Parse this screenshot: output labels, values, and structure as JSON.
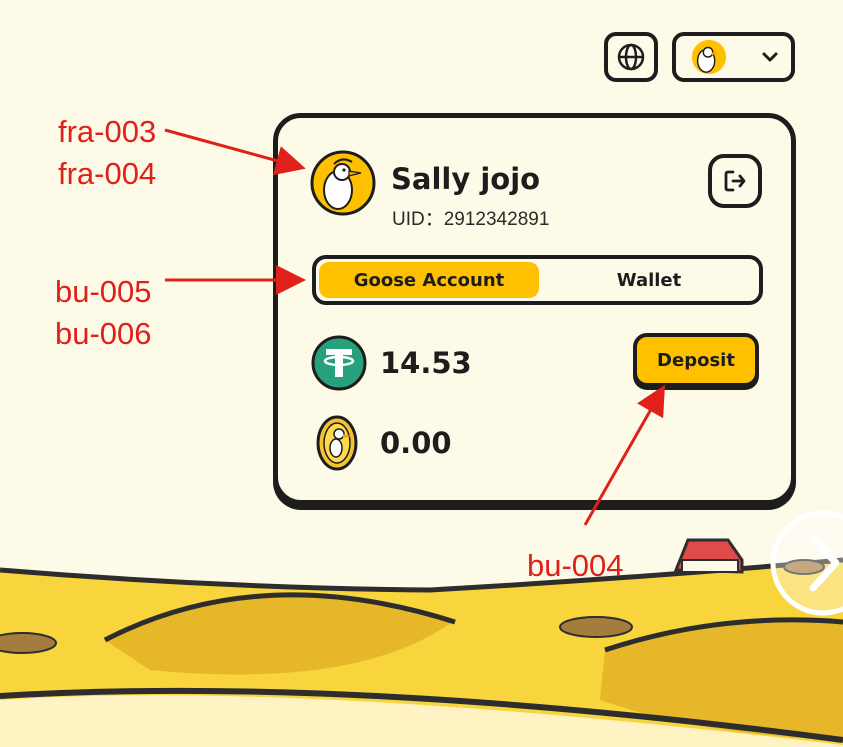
{
  "header": {
    "language_icon": "globe-icon",
    "user_menu_icon": "chevron-down-icon"
  },
  "profile": {
    "name": "Sally jojo",
    "uid": "UID：2912342891"
  },
  "tabs": [
    {
      "label": "Goose Account",
      "active": true
    },
    {
      "label": "Wallet",
      "active": false
    }
  ],
  "balances": [
    {
      "currency_icon": "usdt-tether-icon",
      "amount": "14.53"
    },
    {
      "currency_icon": "goose-coin-icon",
      "amount": "0.00"
    }
  ],
  "actions": {
    "deposit_label": "Deposit",
    "logout_icon": "logout-icon"
  },
  "annotations": {
    "avatar_line1": "fra-003",
    "avatar_line2": "fra-004",
    "tabs_line1": "bu-005",
    "tabs_line2": "bu-006",
    "deposit": "bu-004"
  },
  "colors": {
    "accent": "#ffc000",
    "ink": "#1d1d1d",
    "background": "#fdfbe8",
    "annotation": "#e0201a",
    "usdt": "#26a17b"
  }
}
